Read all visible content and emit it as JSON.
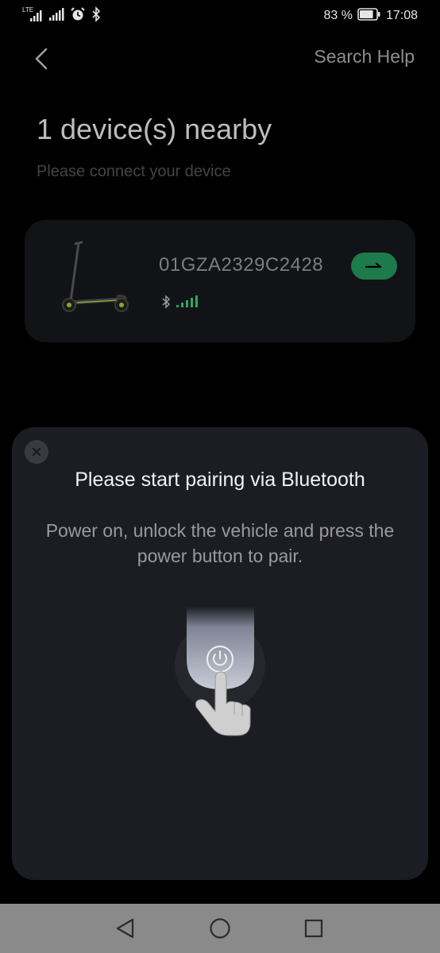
{
  "status_bar": {
    "network_type": "LTE",
    "battery_percent": "83 %",
    "time": "17:08",
    "battery_level": 0.83,
    "icons": [
      "lte-signal-icon",
      "signal-icon",
      "alarm-icon",
      "bluetooth-icon",
      "battery-icon"
    ]
  },
  "header": {
    "back_icon": "chevron-left-icon",
    "search_help": "Search Help"
  },
  "main": {
    "title": "1 device(s) nearby",
    "subtitle": "Please connect your device"
  },
  "device": {
    "id": "01GZA2329C2428",
    "image": "scooter",
    "connection_icons": [
      "bluetooth-icon",
      "signal-strength-icon"
    ],
    "action_icon": "arrow-right-icon",
    "accent_color": "#1d7a4b",
    "signal_color": "#2ea663"
  },
  "sheet": {
    "close_icon": "close-icon",
    "title": "Please start pairing via Bluetooth",
    "description": "Power on, unlock the vehicle and press the power button to pair.",
    "illustration": [
      "power-button-icon",
      "hand-pointer-icon"
    ]
  },
  "nav_bar": {
    "buttons": [
      "back-triangle-icon",
      "home-circle-icon",
      "recents-square-icon"
    ]
  }
}
